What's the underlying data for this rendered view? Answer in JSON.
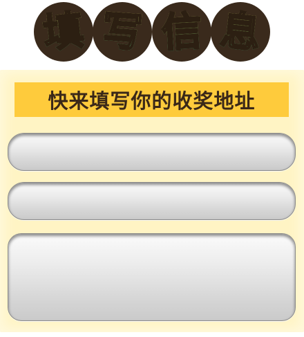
{
  "title": {
    "chars": [
      "填",
      "写",
      "信",
      "息"
    ]
  },
  "panel": {
    "header_text": "快来填写你的收奖地址"
  },
  "form": {
    "name_value": "",
    "phone_value": "",
    "address_value": ""
  },
  "colors": {
    "badge_bg": "#3a2a1c",
    "glyph_gradient_top": "#f7ef7a",
    "glyph_gradient_bottom": "#4fd7a0",
    "panel_bg": "#fff4c4",
    "header_bar": "#fecb3c",
    "header_text": "#3a2818"
  }
}
